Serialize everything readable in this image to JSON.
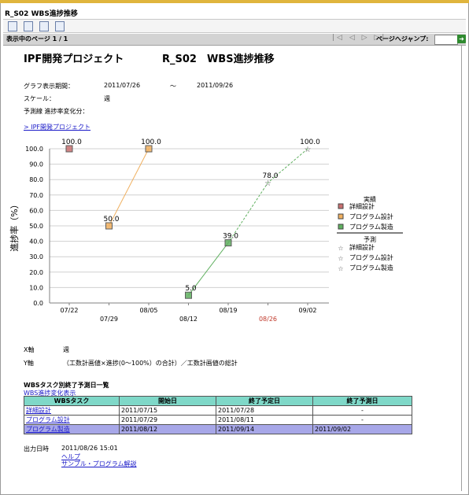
{
  "window": {
    "title": "R_S02 WBS進捗推移"
  },
  "toolbar": {
    "icons": [
      "export-icon",
      "document-icon",
      "export-document-icon",
      "print-icon"
    ]
  },
  "pager": {
    "status": "表示中のページ 1 / 1",
    "arrows": "|◁ ◁ ▷ ▷|",
    "jump_label": "ページへジャンプ:",
    "jump_value": "",
    "go": "➜"
  },
  "report": {
    "project_title": "IPF開発プロジェクト",
    "report_title": "R_S02　WBS進捗推移",
    "period_label": "グラフ表示期間：",
    "period_start": "2011/07/26",
    "period_sep": "～",
    "period_end": "2011/09/26",
    "scale_label": "スケール：",
    "scale_value": "週",
    "forecast_label": "予測線 進捗率変化分：",
    "breadcrumb": "> IPF開発プロジェクト"
  },
  "chart_data": {
    "type": "line",
    "ylabel": "進捗率（%）",
    "ylim": [
      0,
      100
    ],
    "yticks": [
      "0.0",
      "10.0",
      "20.0",
      "30.0",
      "40.0",
      "50.0",
      "60.0",
      "70.0",
      "80.0",
      "90.0",
      "100.0"
    ],
    "x_top": [
      "07/22",
      "08/05",
      "08/19",
      "09/02"
    ],
    "x_bottom": [
      "07/29",
      "08/12",
      "08/26"
    ],
    "x_highlight": "08/26",
    "legend_actual_header": "実績",
    "legend_forecast_header": "予測",
    "series": [
      {
        "name": "詳細設計",
        "kind": "actual",
        "color": "#c87070",
        "points": [
          {
            "x": "07/22",
            "y": 100.0
          }
        ]
      },
      {
        "name": "プログラム設計",
        "kind": "actual",
        "color": "#f0b060",
        "points": [
          {
            "x": "07/29",
            "y": 50.0
          },
          {
            "x": "08/05",
            "y": 100.0
          }
        ]
      },
      {
        "name": "プログラム製造",
        "kind": "actual",
        "color": "#60b060",
        "points": [
          {
            "x": "08/12",
            "y": 5.0
          },
          {
            "x": "08/19",
            "y": 39.0
          }
        ]
      },
      {
        "name": "詳細設計",
        "kind": "forecast",
        "color": "#c87070",
        "points": []
      },
      {
        "name": "プログラム設計",
        "kind": "forecast",
        "color": "#f0b060",
        "points": []
      },
      {
        "name": "プログラム製造",
        "kind": "forecast",
        "color": "#60b060",
        "points": [
          {
            "x": "08/19",
            "y": 39.0
          },
          {
            "x": "08/26",
            "y": 78.0
          },
          {
            "x": "09/02",
            "y": 100.0
          }
        ]
      }
    ],
    "data_labels": [
      {
        "x": "07/22",
        "y": 100.0,
        "text": "100.0"
      },
      {
        "x": "08/05",
        "y": 100.0,
        "text": "100.0"
      },
      {
        "x": "07/29",
        "y": 50.0,
        "text": "50.0"
      },
      {
        "x": "08/12",
        "y": 5.0,
        "text": "5.0"
      },
      {
        "x": "08/19",
        "y": 39.0,
        "text": "39.0"
      },
      {
        "x": "08/26",
        "y": 78.0,
        "text": "78.0"
      },
      {
        "x": "09/02",
        "y": 100.0,
        "text": "100.0"
      }
    ],
    "grid": true
  },
  "axis_notes": {
    "x_label": "X軸",
    "x_value": "週",
    "y_label": "Y軸",
    "y_value": "（工数計画値×進捗(0～100%）の合計）／工数計画値の総計"
  },
  "wbs_section": {
    "title": "WBSタスク別終了予測日一覧",
    "change_link": "WBS進捗変化表示",
    "headers": [
      "WBSタスク",
      "開始日",
      "終了予定日",
      "終了予測日"
    ],
    "rows": [
      {
        "task": "詳細設計",
        "start": "2011/07/15",
        "planned": "2011/07/28",
        "forecast": "-"
      },
      {
        "task": "プログラム設計",
        "start": "2011/07/29",
        "planned": "2011/08/11",
        "forecast": "-"
      },
      {
        "task": "プログラム製造",
        "start": "2011/08/12",
        "planned": "2011/09/14",
        "forecast": "2011/09/02"
      }
    ]
  },
  "footer": {
    "output_label": "出力日時",
    "output_value": "2011/08/26 15:01",
    "help": "ヘルプ",
    "sample": "サンプル・プログラム解説"
  }
}
